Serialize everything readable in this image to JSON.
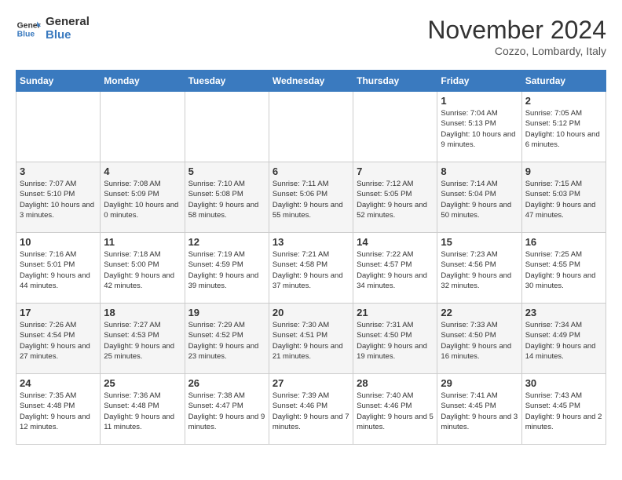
{
  "header": {
    "logo_line1": "General",
    "logo_line2": "Blue",
    "month": "November 2024",
    "location": "Cozzo, Lombardy, Italy"
  },
  "weekdays": [
    "Sunday",
    "Monday",
    "Tuesday",
    "Wednesday",
    "Thursday",
    "Friday",
    "Saturday"
  ],
  "weeks": [
    [
      {
        "day": "",
        "info": ""
      },
      {
        "day": "",
        "info": ""
      },
      {
        "day": "",
        "info": ""
      },
      {
        "day": "",
        "info": ""
      },
      {
        "day": "",
        "info": ""
      },
      {
        "day": "1",
        "info": "Sunrise: 7:04 AM\nSunset: 5:13 PM\nDaylight: 10 hours and 9 minutes."
      },
      {
        "day": "2",
        "info": "Sunrise: 7:05 AM\nSunset: 5:12 PM\nDaylight: 10 hours and 6 minutes."
      }
    ],
    [
      {
        "day": "3",
        "info": "Sunrise: 7:07 AM\nSunset: 5:10 PM\nDaylight: 10 hours and 3 minutes."
      },
      {
        "day": "4",
        "info": "Sunrise: 7:08 AM\nSunset: 5:09 PM\nDaylight: 10 hours and 0 minutes."
      },
      {
        "day": "5",
        "info": "Sunrise: 7:10 AM\nSunset: 5:08 PM\nDaylight: 9 hours and 58 minutes."
      },
      {
        "day": "6",
        "info": "Sunrise: 7:11 AM\nSunset: 5:06 PM\nDaylight: 9 hours and 55 minutes."
      },
      {
        "day": "7",
        "info": "Sunrise: 7:12 AM\nSunset: 5:05 PM\nDaylight: 9 hours and 52 minutes."
      },
      {
        "day": "8",
        "info": "Sunrise: 7:14 AM\nSunset: 5:04 PM\nDaylight: 9 hours and 50 minutes."
      },
      {
        "day": "9",
        "info": "Sunrise: 7:15 AM\nSunset: 5:03 PM\nDaylight: 9 hours and 47 minutes."
      }
    ],
    [
      {
        "day": "10",
        "info": "Sunrise: 7:16 AM\nSunset: 5:01 PM\nDaylight: 9 hours and 44 minutes."
      },
      {
        "day": "11",
        "info": "Sunrise: 7:18 AM\nSunset: 5:00 PM\nDaylight: 9 hours and 42 minutes."
      },
      {
        "day": "12",
        "info": "Sunrise: 7:19 AM\nSunset: 4:59 PM\nDaylight: 9 hours and 39 minutes."
      },
      {
        "day": "13",
        "info": "Sunrise: 7:21 AM\nSunset: 4:58 PM\nDaylight: 9 hours and 37 minutes."
      },
      {
        "day": "14",
        "info": "Sunrise: 7:22 AM\nSunset: 4:57 PM\nDaylight: 9 hours and 34 minutes."
      },
      {
        "day": "15",
        "info": "Sunrise: 7:23 AM\nSunset: 4:56 PM\nDaylight: 9 hours and 32 minutes."
      },
      {
        "day": "16",
        "info": "Sunrise: 7:25 AM\nSunset: 4:55 PM\nDaylight: 9 hours and 30 minutes."
      }
    ],
    [
      {
        "day": "17",
        "info": "Sunrise: 7:26 AM\nSunset: 4:54 PM\nDaylight: 9 hours and 27 minutes."
      },
      {
        "day": "18",
        "info": "Sunrise: 7:27 AM\nSunset: 4:53 PM\nDaylight: 9 hours and 25 minutes."
      },
      {
        "day": "19",
        "info": "Sunrise: 7:29 AM\nSunset: 4:52 PM\nDaylight: 9 hours and 23 minutes."
      },
      {
        "day": "20",
        "info": "Sunrise: 7:30 AM\nSunset: 4:51 PM\nDaylight: 9 hours and 21 minutes."
      },
      {
        "day": "21",
        "info": "Sunrise: 7:31 AM\nSunset: 4:50 PM\nDaylight: 9 hours and 19 minutes."
      },
      {
        "day": "22",
        "info": "Sunrise: 7:33 AM\nSunset: 4:50 PM\nDaylight: 9 hours and 16 minutes."
      },
      {
        "day": "23",
        "info": "Sunrise: 7:34 AM\nSunset: 4:49 PM\nDaylight: 9 hours and 14 minutes."
      }
    ],
    [
      {
        "day": "24",
        "info": "Sunrise: 7:35 AM\nSunset: 4:48 PM\nDaylight: 9 hours and 12 minutes."
      },
      {
        "day": "25",
        "info": "Sunrise: 7:36 AM\nSunset: 4:48 PM\nDaylight: 9 hours and 11 minutes."
      },
      {
        "day": "26",
        "info": "Sunrise: 7:38 AM\nSunset: 4:47 PM\nDaylight: 9 hours and 9 minutes."
      },
      {
        "day": "27",
        "info": "Sunrise: 7:39 AM\nSunset: 4:46 PM\nDaylight: 9 hours and 7 minutes."
      },
      {
        "day": "28",
        "info": "Sunrise: 7:40 AM\nSunset: 4:46 PM\nDaylight: 9 hours and 5 minutes."
      },
      {
        "day": "29",
        "info": "Sunrise: 7:41 AM\nSunset: 4:45 PM\nDaylight: 9 hours and 3 minutes."
      },
      {
        "day": "30",
        "info": "Sunrise: 7:43 AM\nSunset: 4:45 PM\nDaylight: 9 hours and 2 minutes."
      }
    ]
  ]
}
